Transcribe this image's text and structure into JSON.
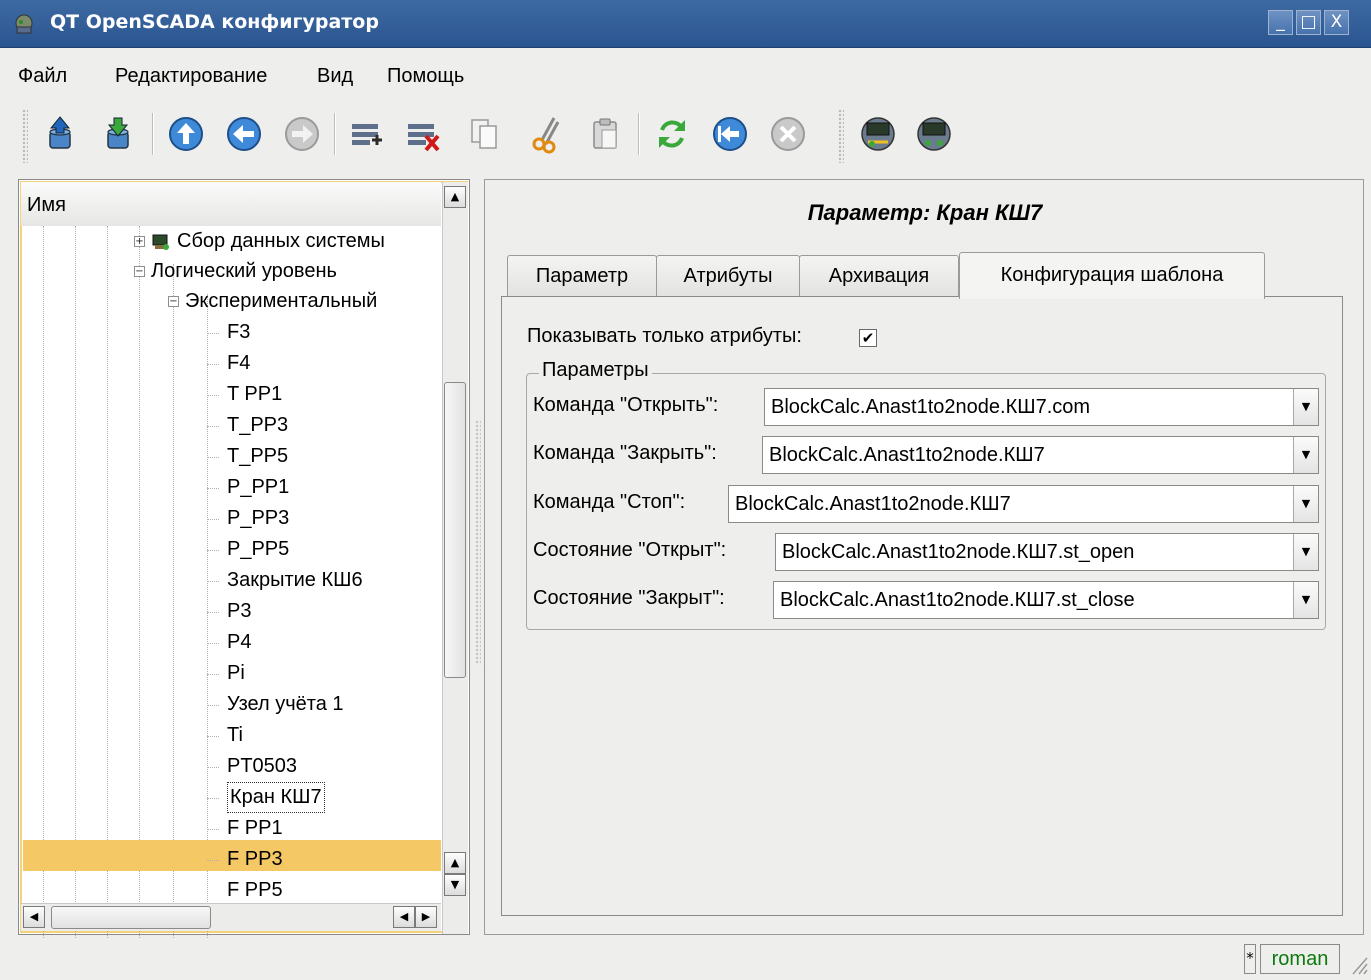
{
  "window": {
    "title": "QT OpenSCADA конфигуратор",
    "minimize_glyph": "_",
    "maximize_glyph": "□",
    "close_glyph": "X"
  },
  "menubar": {
    "items": [
      "Файл",
      "Редактирование",
      "Вид",
      "Помощь"
    ]
  },
  "toolbar": {
    "icons": [
      "db-load-icon",
      "db-save-icon",
      "up-icon",
      "back-icon",
      "forward-icon",
      "add-item-icon",
      "delete-item-icon",
      "copy-icon",
      "cut-icon",
      "paste-icon",
      "refresh-icon",
      "start-icon",
      "stop-icon",
      "connect-station-icon",
      "station-icon"
    ]
  },
  "tree": {
    "header": "Имя",
    "items": [
      "Сбор данных системы",
      "Логический уровень",
      "Экспериментальный",
      "F3",
      "F4",
      "T PP1",
      "T_PP3",
      "T_PP5",
      "P_PP1",
      "P_PP3",
      "P_PP5",
      "Закрытие КШ6",
      "P3",
      "P4",
      "Pi",
      "Узел учёта 1",
      "Ti",
      "PT0503",
      "Кран КШ7",
      "F PP1",
      "F PP3",
      "F PP5"
    ],
    "selected": "Кран КШ7",
    "up_arrow": "▲",
    "down_arrow": "▼",
    "left_arrow": "◀",
    "right_arrow": "▶"
  },
  "page": {
    "title": "Параметр: Кран КШ7",
    "tabs": [
      "Параметр",
      "Атрибуты",
      "Архивация",
      "Конфигурация шаблона"
    ],
    "active_tab": "Конфигурация шаблона",
    "show_only_attrs_label": "Показывать только атрибуты:",
    "show_only_attrs_checked": "✔",
    "group_title": "Параметры",
    "fields": [
      {
        "label": "Команда \"Открыть\":",
        "value": "BlockCalc.Anast1to2node.КШ7.com"
      },
      {
        "label": "Команда \"Закрыть\":",
        "value": "BlockCalc.Anast1to2node.КШ7"
      },
      {
        "label": "Команда \"Стоп\":",
        "value": "BlockCalc.Anast1to2node.КШ7"
      },
      {
        "label": "Состояние \"Открыт\":",
        "value": "BlockCalc.Anast1to2node.КШ7.st_open"
      },
      {
        "label": "Состояние \"Закрыт\":",
        "value": "BlockCalc.Anast1to2node.КШ7.st_close"
      }
    ],
    "combo_arrow": "▼"
  },
  "statusbar": {
    "modified": "*",
    "user": "roman"
  },
  "colors": {
    "titlebar": "#3e6aa3",
    "selection": "#f4c965",
    "user_text": "#0d7a0d"
  }
}
